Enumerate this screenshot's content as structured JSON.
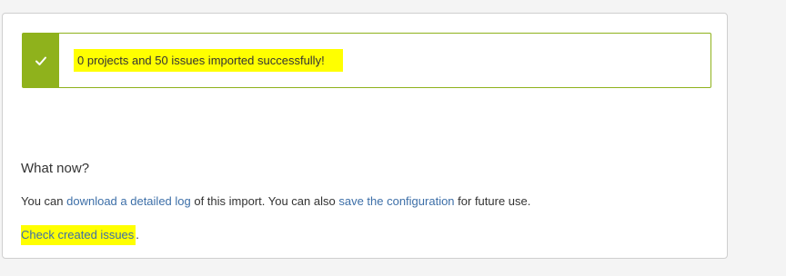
{
  "alert": {
    "icon": "checkmark-icon",
    "message": "0 projects and 50 issues imported successfully!",
    "accent_color": "#8fb21c",
    "highlight_color": "#ffff00"
  },
  "next_steps": {
    "heading": "What now?",
    "line1": {
      "prefix": "You can ",
      "log_link": "download a detailed log",
      "middle": " of this import. You can also ",
      "config_link": "save the configuration",
      "suffix": " for future use."
    },
    "line2": {
      "issues_link": "Check created issues",
      "suffix": "."
    },
    "link_color": "#3d6fa8"
  }
}
